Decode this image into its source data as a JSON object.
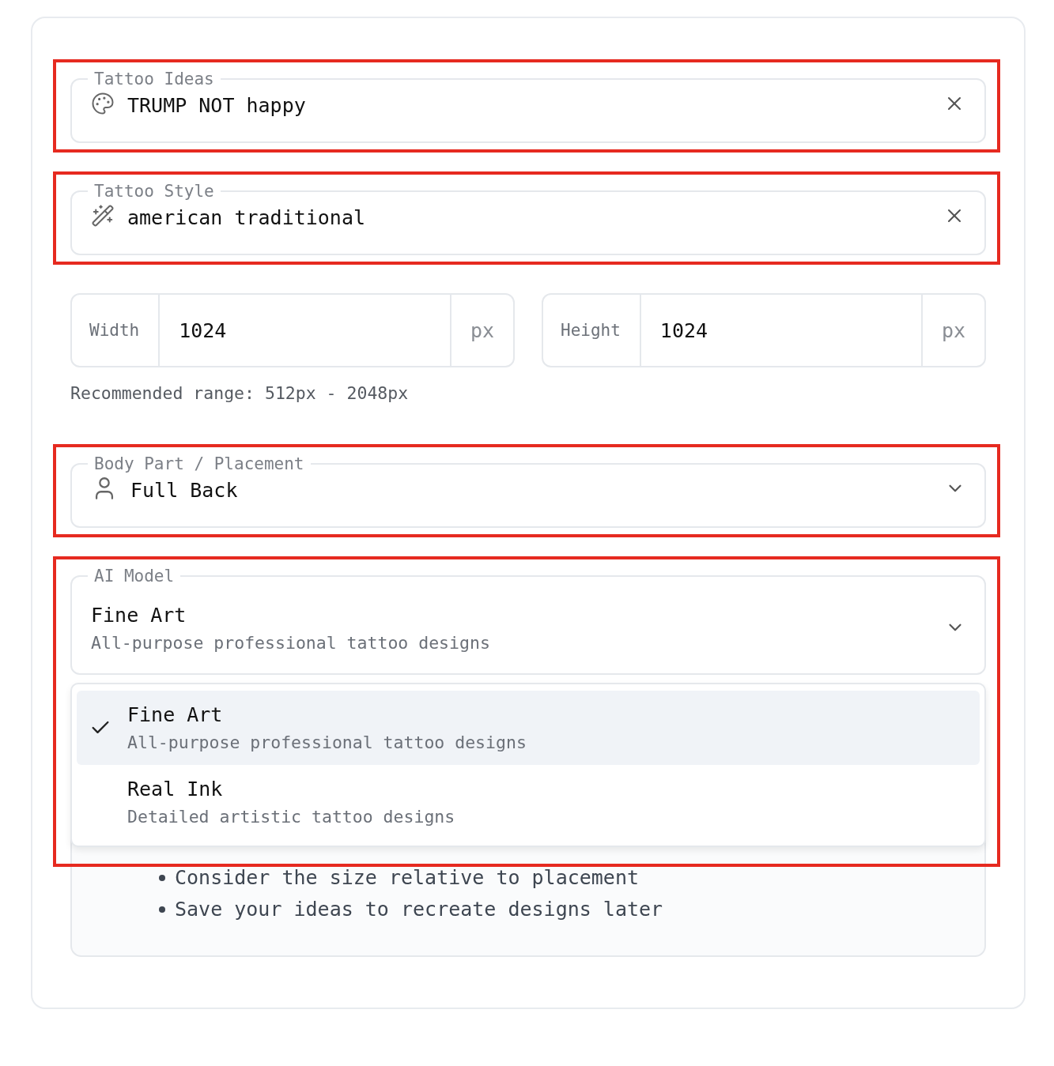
{
  "tattoo_ideas": {
    "label": "Tattoo Ideas",
    "value": "TRUMP NOT happy",
    "highlighted": true
  },
  "tattoo_style": {
    "label": "Tattoo Style",
    "value": "american traditional",
    "highlighted": true
  },
  "dimensions": {
    "fields": [
      {
        "label": "Width",
        "value": "1024",
        "unit": "px"
      },
      {
        "label": "Height",
        "value": "1024",
        "unit": "px"
      }
    ],
    "hint": "Recommended range: 512px - 2048px"
  },
  "body_part": {
    "label": "Body Part / Placement",
    "value": "Full Back",
    "highlighted": true
  },
  "ai_model": {
    "label": "AI Model",
    "value": "Fine Art",
    "description": "All-purpose professional tattoo designs",
    "highlighted": true,
    "expanded": true,
    "options": [
      {
        "title": "Fine Art",
        "description": "All-purpose professional tattoo designs",
        "selected": true
      },
      {
        "title": "Real Ink",
        "description": "Detailed artistic tattoo designs",
        "selected": false
      }
    ]
  },
  "tips": {
    "items": [
      "Consider the size relative to placement",
      "Save your ideas to recreate designs later"
    ]
  }
}
